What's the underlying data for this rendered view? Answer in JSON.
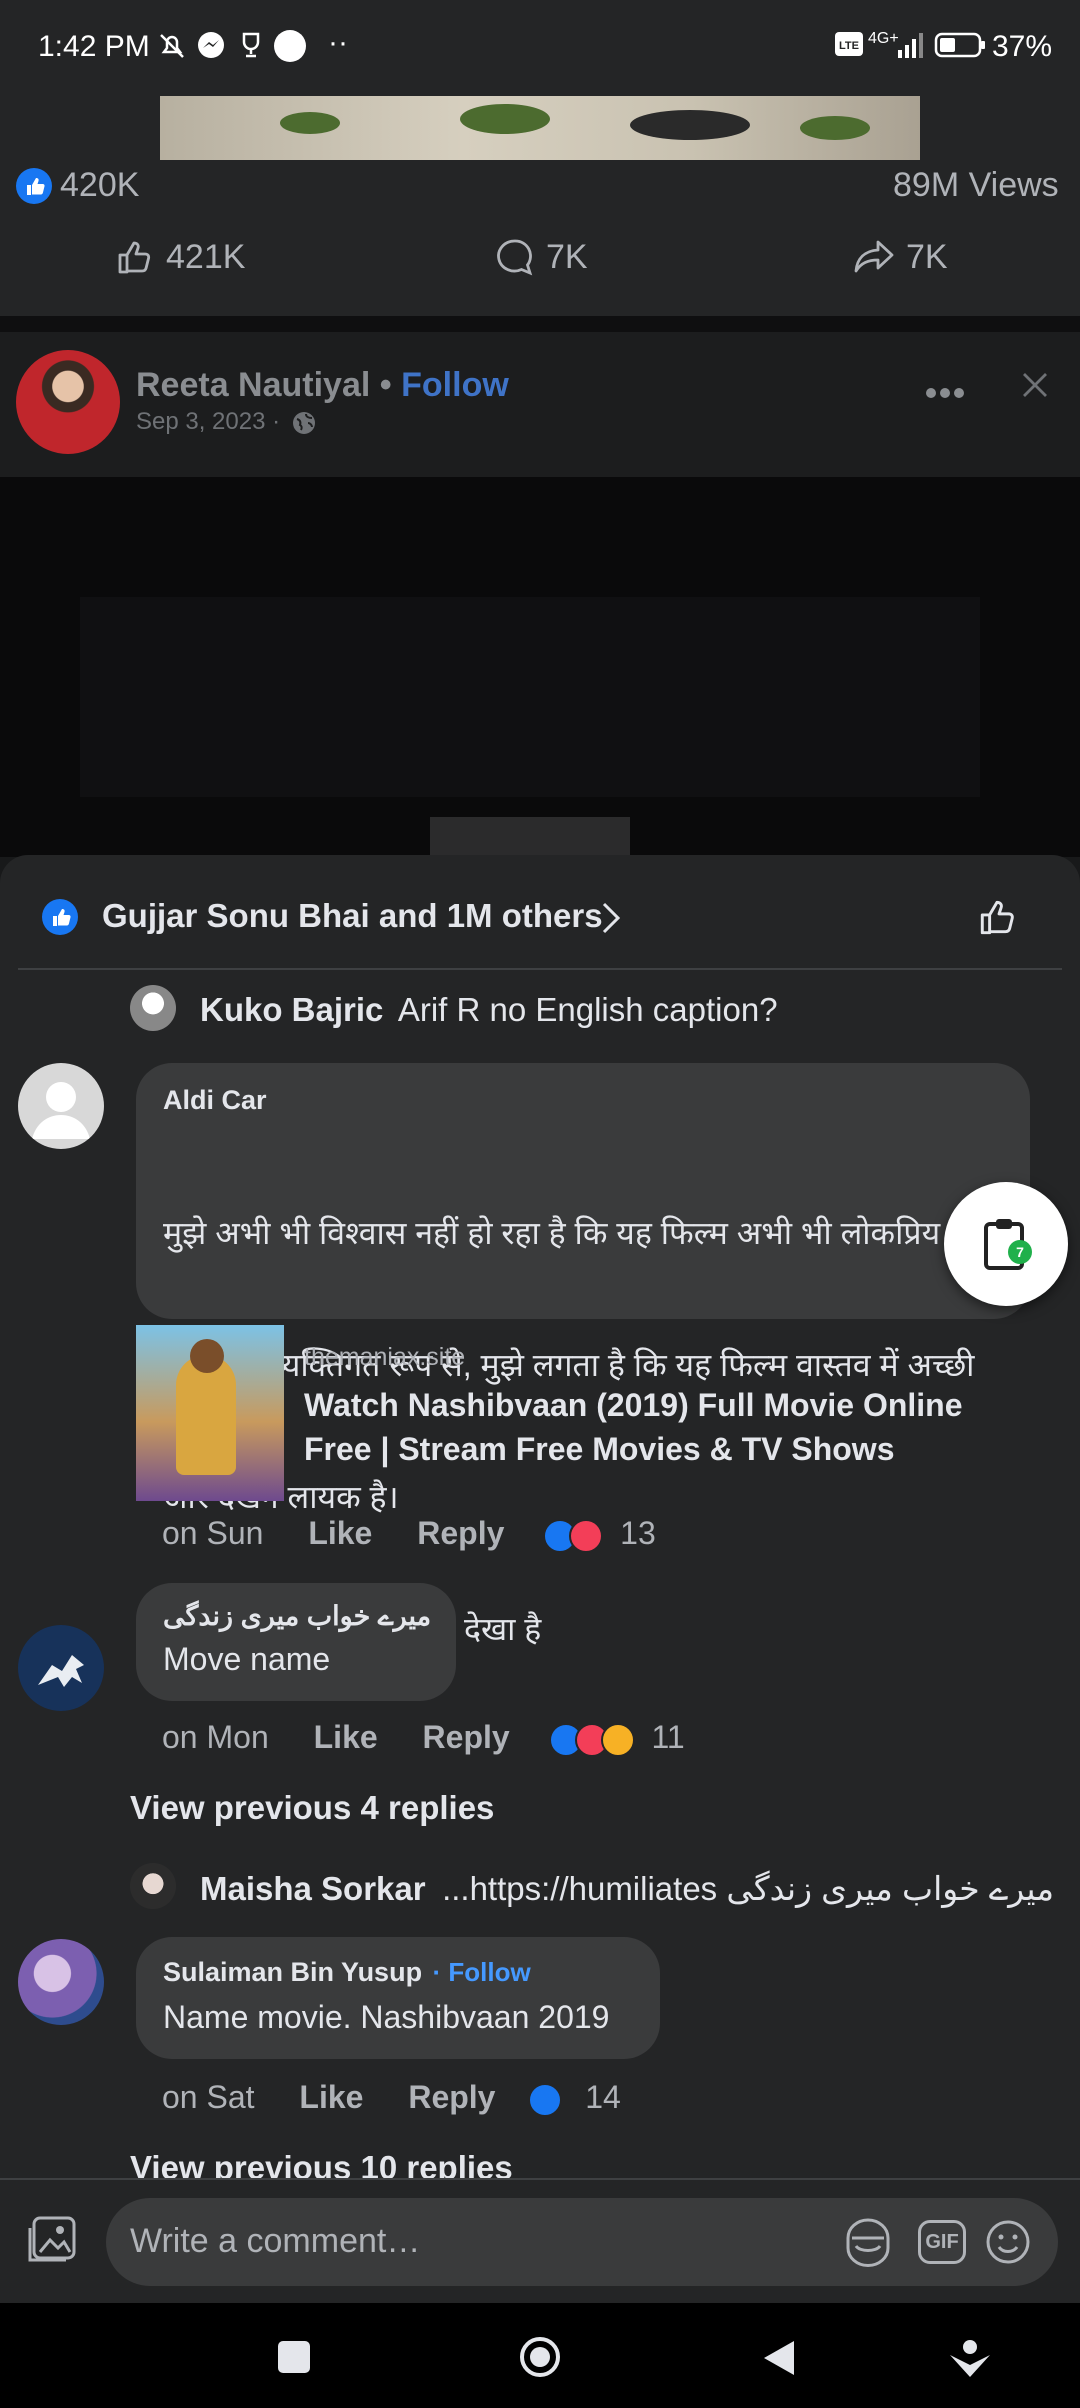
{
  "status_bar": {
    "time": "1:42 PM",
    "battery": "37%",
    "network": "4G+"
  },
  "feed_stats": {
    "reactions": "420K",
    "views": "89M Views",
    "like_count": "421K",
    "comment_count": "7K",
    "share_count": "7K"
  },
  "post": {
    "author": "Reeta Nautiyal",
    "separator": "•",
    "follow_label": "Follow",
    "date": "Sep 3, 2023 ·"
  },
  "sheet": {
    "reactions_summary": "Gujjar Sonu Bhai and 1M others",
    "comments": [
      {
        "name": "Kuko Bajric",
        "text": "Arif R no English caption?"
      },
      {
        "name": "Aldi Car",
        "lines": [
          "मुझे अभी भी विश्वास नहीं हो रहा है कि यह फिल्म अभी भी लोकप्रिय है।",
          "   लेकिन व्यक्तिगत रूप से, मुझे लगता है कि यह फिल्म वास्तव में अच्छी",
          "और देखने लायक है।",
          "  क्योंकि मैंने इसे पहले भी देखा है"
        ],
        "link": {
          "domain": "themaniax.site",
          "title": "Watch Nashibvaan (2019) Full Movie Online Free | Stream Free Movies & TV Shows"
        },
        "time": "on Sun",
        "like": "Like",
        "reply": "Reply",
        "reaction_count": "13"
      },
      {
        "name": "میرے خواب میری زندگی",
        "text": "Move name",
        "time": "on Mon",
        "like": "Like",
        "reply": "Reply",
        "reaction_count": "11"
      },
      {
        "view_previous": "View previous 4 replies"
      },
      {
        "name": "Maisha Sorkar",
        "text": "...https://humiliates میرے خواب میری زندگی"
      },
      {
        "name": "Sulaiman Bin Yusup",
        "follow_label": "· Follow",
        "text": "Name movie. Nashibvaan 2019",
        "time": "on Sat",
        "like": "Like",
        "reply": "Reply",
        "reaction_count": "14"
      },
      {
        "view_previous": "View previous 10 replies"
      }
    ]
  },
  "composer": {
    "placeholder": "Write a comment…",
    "gif_label": "GIF"
  },
  "colors": {
    "accent": "#1877f2",
    "love": "#f33e58",
    "care": "#f7b125"
  }
}
